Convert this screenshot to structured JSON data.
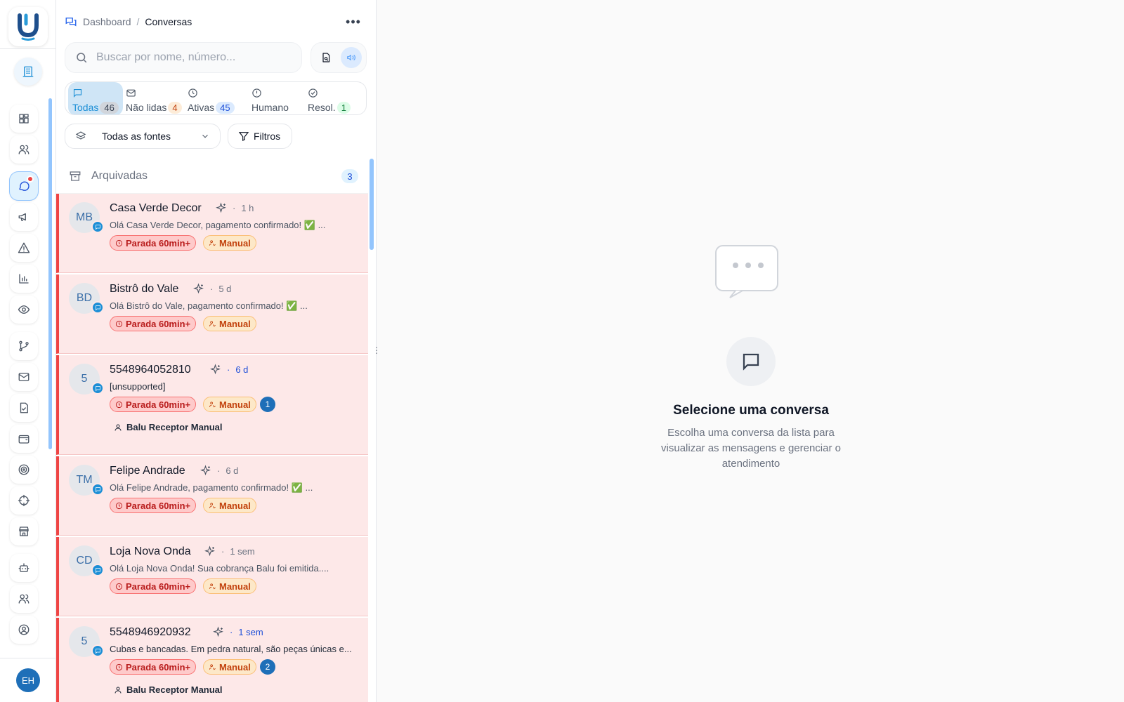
{
  "breadcrumb": {
    "root": "Dashboard",
    "separator": "/",
    "current": "Conversas"
  },
  "more_label": "•••",
  "search": {
    "placeholder": "Buscar por nome, número..."
  },
  "tabs": [
    {
      "label": "Todas",
      "count": "46"
    },
    {
      "label": "Não lidas",
      "count": "4"
    },
    {
      "label": "Ativas",
      "count": "45"
    },
    {
      "label": "Humano",
      "count": ""
    },
    {
      "label": "Resol.",
      "count": "1"
    }
  ],
  "source_select": {
    "value": "Todas as fontes"
  },
  "filters_label": "Filtros",
  "archived": {
    "label": "Arquivadas",
    "count": "3"
  },
  "conversations": [
    {
      "initials": "MB",
      "name": "Casa Verde Decor",
      "time": "1 h",
      "preview": "Olá Casa Verde Decor, pagamento confirmado! ✅ ...",
      "status": "Parada 60min+",
      "mode": "Manual",
      "unread": "",
      "assignee": ""
    },
    {
      "initials": "BD",
      "name": "Bistrô do Vale",
      "time": "5 d",
      "preview": "Olá Bistrô do Vale, pagamento confirmado! ✅ ...",
      "status": "Parada 60min+",
      "mode": "Manual",
      "unread": "",
      "assignee": ""
    },
    {
      "initials": "5",
      "name": "5548964052810",
      "time": "6 d",
      "preview": "[unsupported]",
      "status": "Parada 60min+",
      "mode": "Manual",
      "unread": "1",
      "assignee": "Balu Receptor Manual"
    },
    {
      "initials": "TM",
      "name": "Felipe Andrade",
      "time": "6 d",
      "preview": "Olá Felipe Andrade, pagamento confirmado! ✅ ...",
      "status": "Parada 60min+",
      "mode": "Manual",
      "unread": "",
      "assignee": ""
    },
    {
      "initials": "CD",
      "name": "Loja Nova Onda",
      "time": "1 sem",
      "preview": "Olá Loja Nova Onda! Sua cobrança Balu foi emitida....",
      "status": "Parada 60min+",
      "mode": "Manual",
      "unread": "",
      "assignee": ""
    },
    {
      "initials": "5",
      "name": "5548946920932",
      "time": "1 sem",
      "preview": "Cubas e bancadas. Em pedra natural, são peças únicas e...",
      "status": "Parada 60min+",
      "mode": "Manual",
      "unread": "2",
      "assignee": "Balu Receptor Manual"
    }
  ],
  "empty_state": {
    "title": "Selecione uma conversa",
    "description": "Escolha uma conversa da lista para visualizar as mensagens e gerenciar o atendimento"
  },
  "user_avatar": "EH",
  "colors": {
    "accent": "#1d8fd6",
    "alert_red": "#ef4444",
    "row_bg": "#fde8e8",
    "manual_orange": "#c2410c"
  }
}
